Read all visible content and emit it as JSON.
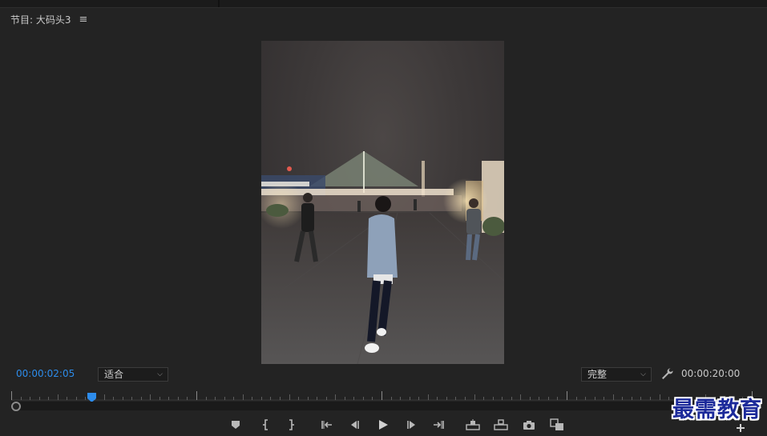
{
  "panel": {
    "title": "节目: 大码头3",
    "menu_icon": "hamburger-icon"
  },
  "monitor": {
    "current_timecode": "00:00:02:05",
    "total_timecode": "00:00:20:00",
    "zoom_select": {
      "selected": "适合"
    },
    "quality_select": {
      "selected": "完整"
    }
  },
  "transport": {
    "buttons": [
      {
        "name": "add-marker",
        "icon": "marker-icon"
      },
      {
        "name": "mark-in",
        "icon": "mark-in-icon"
      },
      {
        "name": "mark-out",
        "icon": "mark-out-icon"
      },
      {
        "name": "go-to-in",
        "icon": "go-to-in-icon"
      },
      {
        "name": "step-back",
        "icon": "step-back-icon"
      },
      {
        "name": "play",
        "icon": "play-icon"
      },
      {
        "name": "step-forward",
        "icon": "step-forward-icon"
      },
      {
        "name": "go-to-out",
        "icon": "go-to-out-icon"
      },
      {
        "name": "lift",
        "icon": "lift-icon"
      },
      {
        "name": "extract",
        "icon": "extract-icon"
      },
      {
        "name": "export-frame",
        "icon": "camera-icon"
      },
      {
        "name": "comparison-view",
        "icon": "comparison-icon"
      }
    ]
  },
  "colors": {
    "accent": "#2d8ceb",
    "panel_bg": "#232323"
  },
  "watermark": {
    "text": "最需教育"
  }
}
